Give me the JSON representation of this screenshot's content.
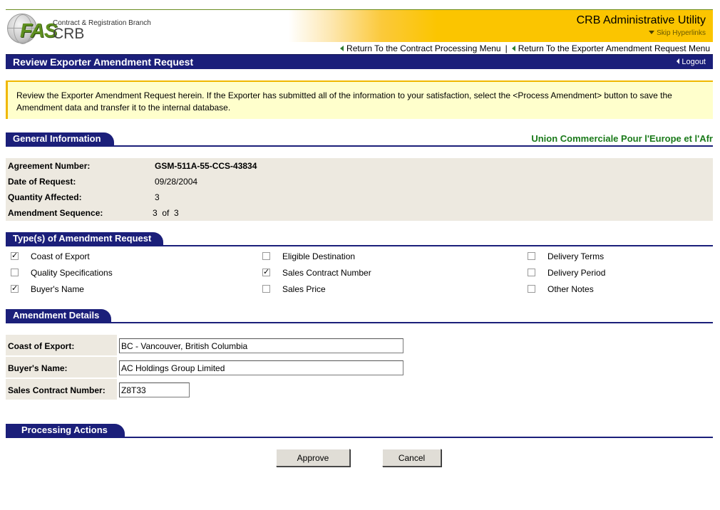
{
  "header": {
    "logo_fas": "FAS",
    "logo_crb": "CRB",
    "logo_branch": "Contract & Registration Branch",
    "utility_title": "CRB Administrative Utility",
    "skip_hyperlinks": "Skip Hyperlinks"
  },
  "nav": {
    "contract_menu": "Return To the Contract Processing Menu",
    "amendment_menu": "Return To the Exporter Amendment Request Menu",
    "separator": "|"
  },
  "pagebar": {
    "title": "Review Exporter Amendment Request",
    "logout": "Logout"
  },
  "instructions": "Review the Exporter Amendment Request herein.  If the Exporter has submitted all of the information to your satisfaction, select the <Process Amendment> button to save the Amendment data and transfer it to the internal database.",
  "general": {
    "section_title": "General Information",
    "exporter_name": "Union Commerciale Pour l'Europe et l'Afr",
    "rows": [
      {
        "label": "Agreement Number:",
        "value": "GSM-511A-55-CCS-43834"
      },
      {
        "label": "Date of Request:",
        "value": "09/28/2004"
      },
      {
        "label": "Quantity Affected:",
        "value": "3"
      },
      {
        "label": "Amendment Sequence:",
        "value": "3  of  3"
      }
    ]
  },
  "types": {
    "section_title": "Type(s) of Amendment Request",
    "items": [
      {
        "label": "Coast of Export",
        "checked": true
      },
      {
        "label": "Quality Specifications",
        "checked": false
      },
      {
        "label": "Buyer's Name",
        "checked": true
      },
      {
        "label": "Eligible Destination",
        "checked": false
      },
      {
        "label": "Sales Contract Number",
        "checked": true
      },
      {
        "label": "Sales Price",
        "checked": false
      },
      {
        "label": "Delivery Terms",
        "checked": false
      },
      {
        "label": "Delivery Period",
        "checked": false
      },
      {
        "label": "Other Notes",
        "checked": false
      }
    ]
  },
  "details": {
    "section_title": "Amendment Details",
    "coast_label": "Coast of Export:",
    "coast_value": "BC - Vancouver, British Columbia",
    "buyer_label": "Buyer's Name:",
    "buyer_value": "AC Holdings Group Limited",
    "contract_label": "Sales Contract Number:",
    "contract_value": "Z8T33"
  },
  "actions": {
    "section_title": "Processing Actions",
    "approve": "Approve",
    "cancel": "Cancel"
  },
  "colors": {
    "navy": "#1b1f7a",
    "banner_gold": "#fbc500",
    "exporter_green": "#1a7a1a",
    "instructions_bg": "#ffffcc"
  }
}
